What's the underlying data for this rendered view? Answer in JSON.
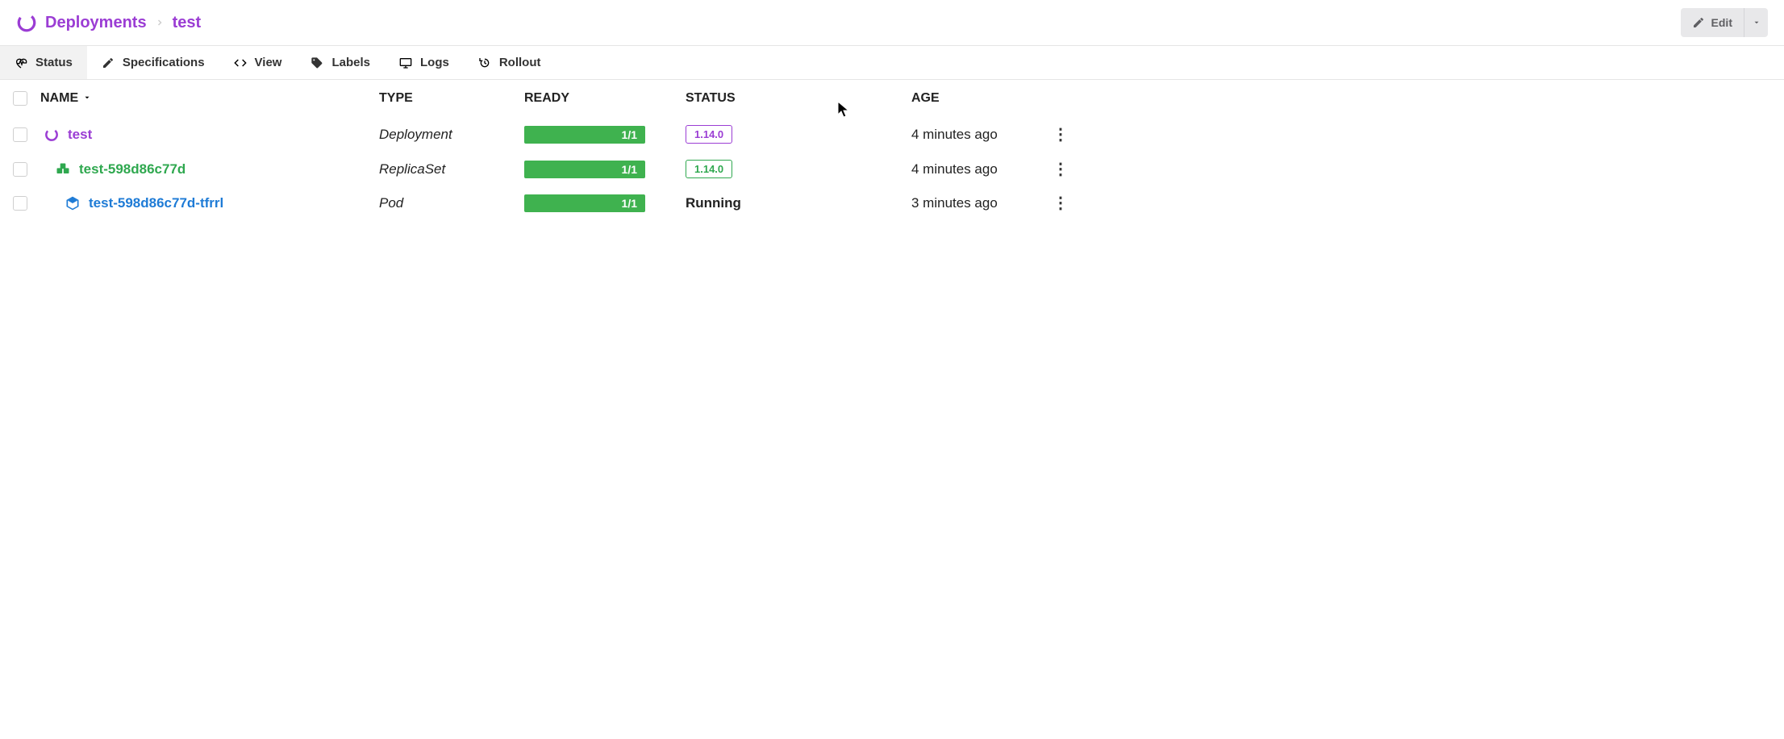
{
  "breadcrumb": {
    "root": "Deployments",
    "current": "test"
  },
  "actions": {
    "edit": "Edit"
  },
  "tabs": [
    {
      "label": "Status"
    },
    {
      "label": "Specifications"
    },
    {
      "label": "View"
    },
    {
      "label": "Labels"
    },
    {
      "label": "Logs"
    },
    {
      "label": "Rollout"
    }
  ],
  "columns": {
    "name": "NAME",
    "type": "TYPE",
    "ready": "READY",
    "status": "STATUS",
    "age": "AGE"
  },
  "rows": [
    {
      "name": "test",
      "type": "Deployment",
      "ready": "1/1",
      "status": "1.14.0",
      "status_kind": "badge-purple",
      "age": "4 minutes ago"
    },
    {
      "name": "test-598d86c77d",
      "type": "ReplicaSet",
      "ready": "1/1",
      "status": "1.14.0",
      "status_kind": "badge-green",
      "age": "4 minutes ago"
    },
    {
      "name": "test-598d86c77d-tfrrl",
      "type": "Pod",
      "ready": "1/1",
      "status": "Running",
      "status_kind": "text",
      "age": "3 minutes ago"
    }
  ]
}
